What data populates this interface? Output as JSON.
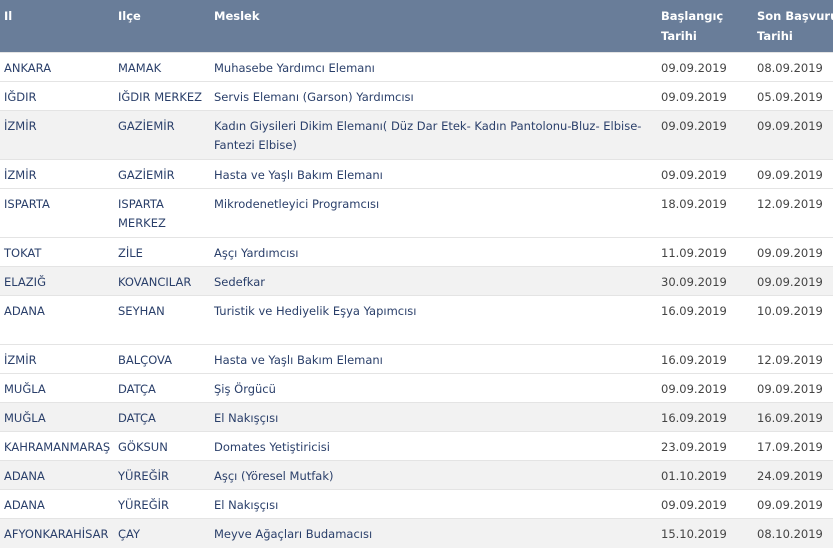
{
  "table": {
    "headers": {
      "il": "Il",
      "ilce": "Ilçe",
      "meslek": "Meslek",
      "baslangic": "Başlangıç Tarihi",
      "son": "Son Başvuru Tarihi"
    },
    "rows": [
      {
        "il": "ANKARA",
        "ilce": "MAMAK",
        "meslek": "Muhasebe Yardımcı Elemanı",
        "baslangic": "09.09.2019",
        "son": "08.09.2019"
      },
      {
        "il": "IĞDIR",
        "ilce": "IĞDIR MERKEZ",
        "meslek": "Servis Elemanı (Garson) Yardımcısı",
        "baslangic": "09.09.2019",
        "son": "05.09.2019"
      },
      {
        "il": "İZMİR",
        "ilce": "GAZİEMİR",
        "meslek": "Kadın Giysileri Dikim Elemanı( Düz Dar Etek- Kadın Pantolonu-Bluz- Elbise-Fantezi Elbise)",
        "baslangic": "09.09.2019",
        "son": "09.09.2019"
      },
      {
        "il": "İZMİR",
        "ilce": "GAZİEMİR",
        "meslek": "Hasta ve Yaşlı Bakım Elemanı",
        "baslangic": "09.09.2019",
        "son": "09.09.2019"
      },
      {
        "il": "ISPARTA",
        "ilce": "ISPARTA MERKEZ",
        "meslek": "Mikrodenetleyici Programcısı",
        "baslangic": "18.09.2019",
        "son": "12.09.2019"
      },
      {
        "il": "TOKAT",
        "ilce": "ZİLE",
        "meslek": "Aşçı Yardımcısı",
        "baslangic": "11.09.2019",
        "son": "09.09.2019"
      },
      {
        "il": "ELAZIĞ",
        "ilce": "KOVANCILAR",
        "meslek": "Sedefkar",
        "baslangic": "30.09.2019",
        "son": "09.09.2019"
      },
      {
        "il": "ADANA",
        "ilce": "SEYHAN",
        "meslek": "Turistik ve Hediyelik Eşya Yapımcısı",
        "baslangic": "16.09.2019",
        "son": "10.09.2019"
      },
      {
        "il": "İZMİR",
        "ilce": "BALÇOVA",
        "meslek": "Hasta ve Yaşlı Bakım Elemanı",
        "baslangic": "16.09.2019",
        "son": "12.09.2019"
      },
      {
        "il": "MUĞLA",
        "ilce": "DATÇA",
        "meslek": "Şiş Örgücü",
        "baslangic": "09.09.2019",
        "son": "09.09.2019"
      },
      {
        "il": "MUĞLA",
        "ilce": "DATÇA",
        "meslek": "El Nakışçısı",
        "baslangic": "16.09.2019",
        "son": "16.09.2019"
      },
      {
        "il": "KAHRAMANMARAŞ",
        "ilce": "GÖKSUN",
        "meslek": "Domates Yetiştiricisi",
        "baslangic": "23.09.2019",
        "son": "17.09.2019"
      },
      {
        "il": "ADANA",
        "ilce": "YÜREĞİR",
        "meslek": "Aşçı (Yöresel Mutfak)",
        "baslangic": "01.10.2019",
        "son": "24.09.2019"
      },
      {
        "il": "ADANA",
        "ilce": "YÜREĞİR",
        "meslek": "El Nakışçısı",
        "baslangic": "09.09.2019",
        "son": "09.09.2019"
      },
      {
        "il": "AFYONKARAHİSAR",
        "ilce": "ÇAY",
        "meslek": "Meyve Ağaçları Budamacısı",
        "baslangic": "15.10.2019",
        "son": "08.10.2019"
      }
    ]
  }
}
